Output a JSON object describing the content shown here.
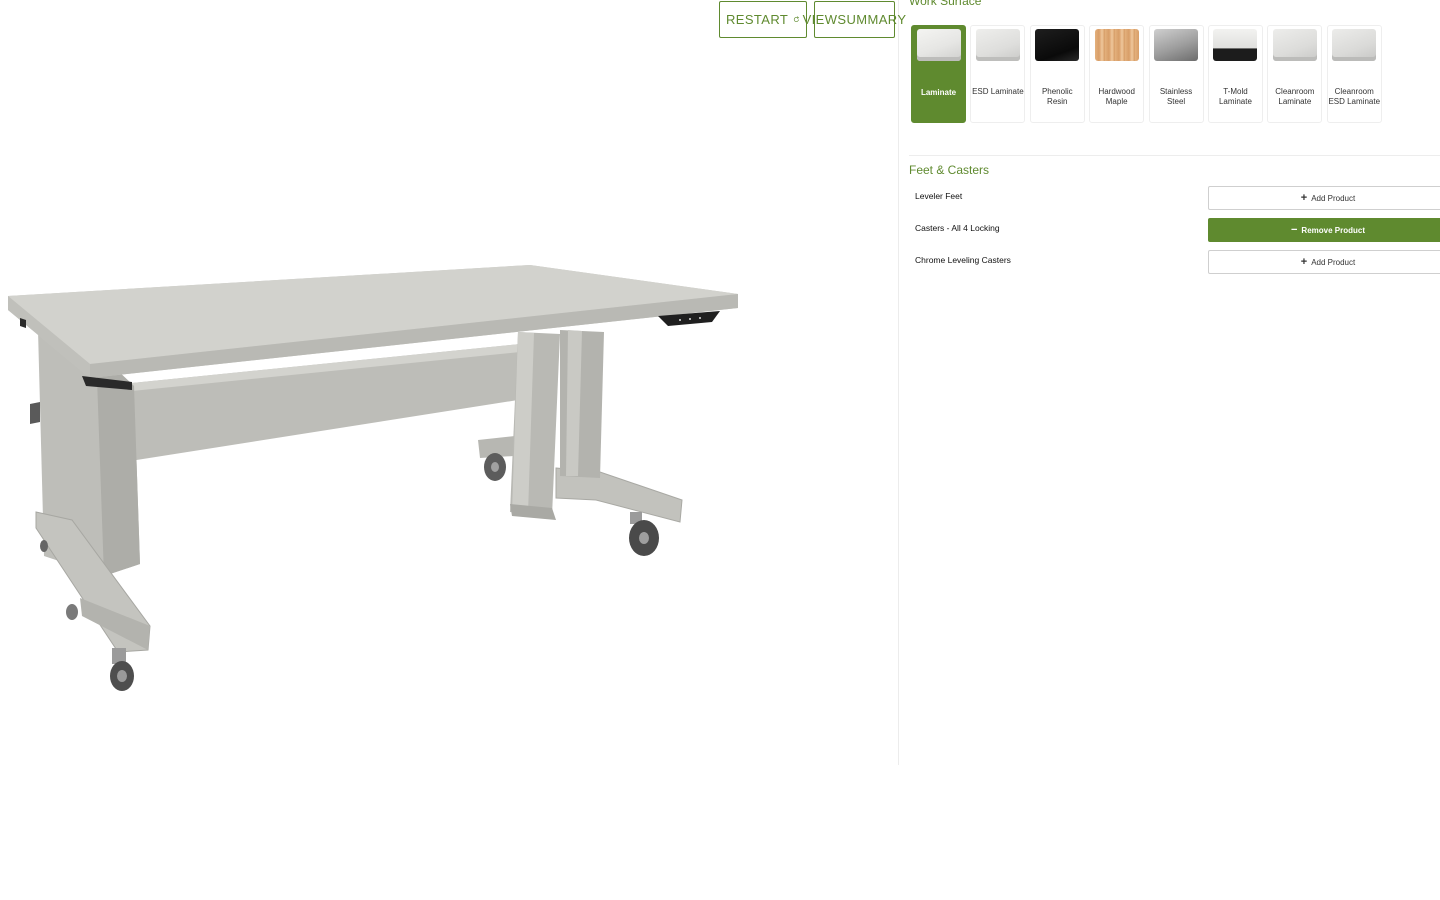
{
  "toolbar": {
    "restart_label": "RESTART",
    "summary_line1": "VIEW",
    "summary_line2": "SUMMARY"
  },
  "work_surface": {
    "title": "Work Surface",
    "options": [
      {
        "label": "Laminate",
        "swatch": "laminate",
        "selected": true
      },
      {
        "label": "ESD Laminate",
        "swatch": "esd",
        "selected": false
      },
      {
        "label": "Phenolic Resin",
        "swatch": "phenolic",
        "selected": false
      },
      {
        "label": "Hardwood Maple",
        "swatch": "maple",
        "selected": false
      },
      {
        "label": "Stainless Steel",
        "swatch": "steel",
        "selected": false
      },
      {
        "label": "T-Mold Laminate",
        "swatch": "tmold",
        "selected": false
      },
      {
        "label": "Cleanroom Laminate",
        "swatch": "cleanroom",
        "selected": false
      },
      {
        "label": "Cleanroom ESD Laminate",
        "swatch": "cleanroom-esd",
        "selected": false
      }
    ]
  },
  "feet_casters": {
    "title": "Feet & Casters",
    "options": [
      {
        "label": "Leveler Feet",
        "button": "Add Product",
        "added": false
      },
      {
        "label": "Casters - All 4 Locking",
        "button": "Remove Product",
        "added": true
      },
      {
        "label": "Chrome Leveling Casters",
        "button": "Add Product",
        "added": false
      }
    ]
  },
  "colors": {
    "accent": "#5f8a2f",
    "table_surface": "#c8c8c3",
    "table_frame": "#b5b5b0"
  }
}
